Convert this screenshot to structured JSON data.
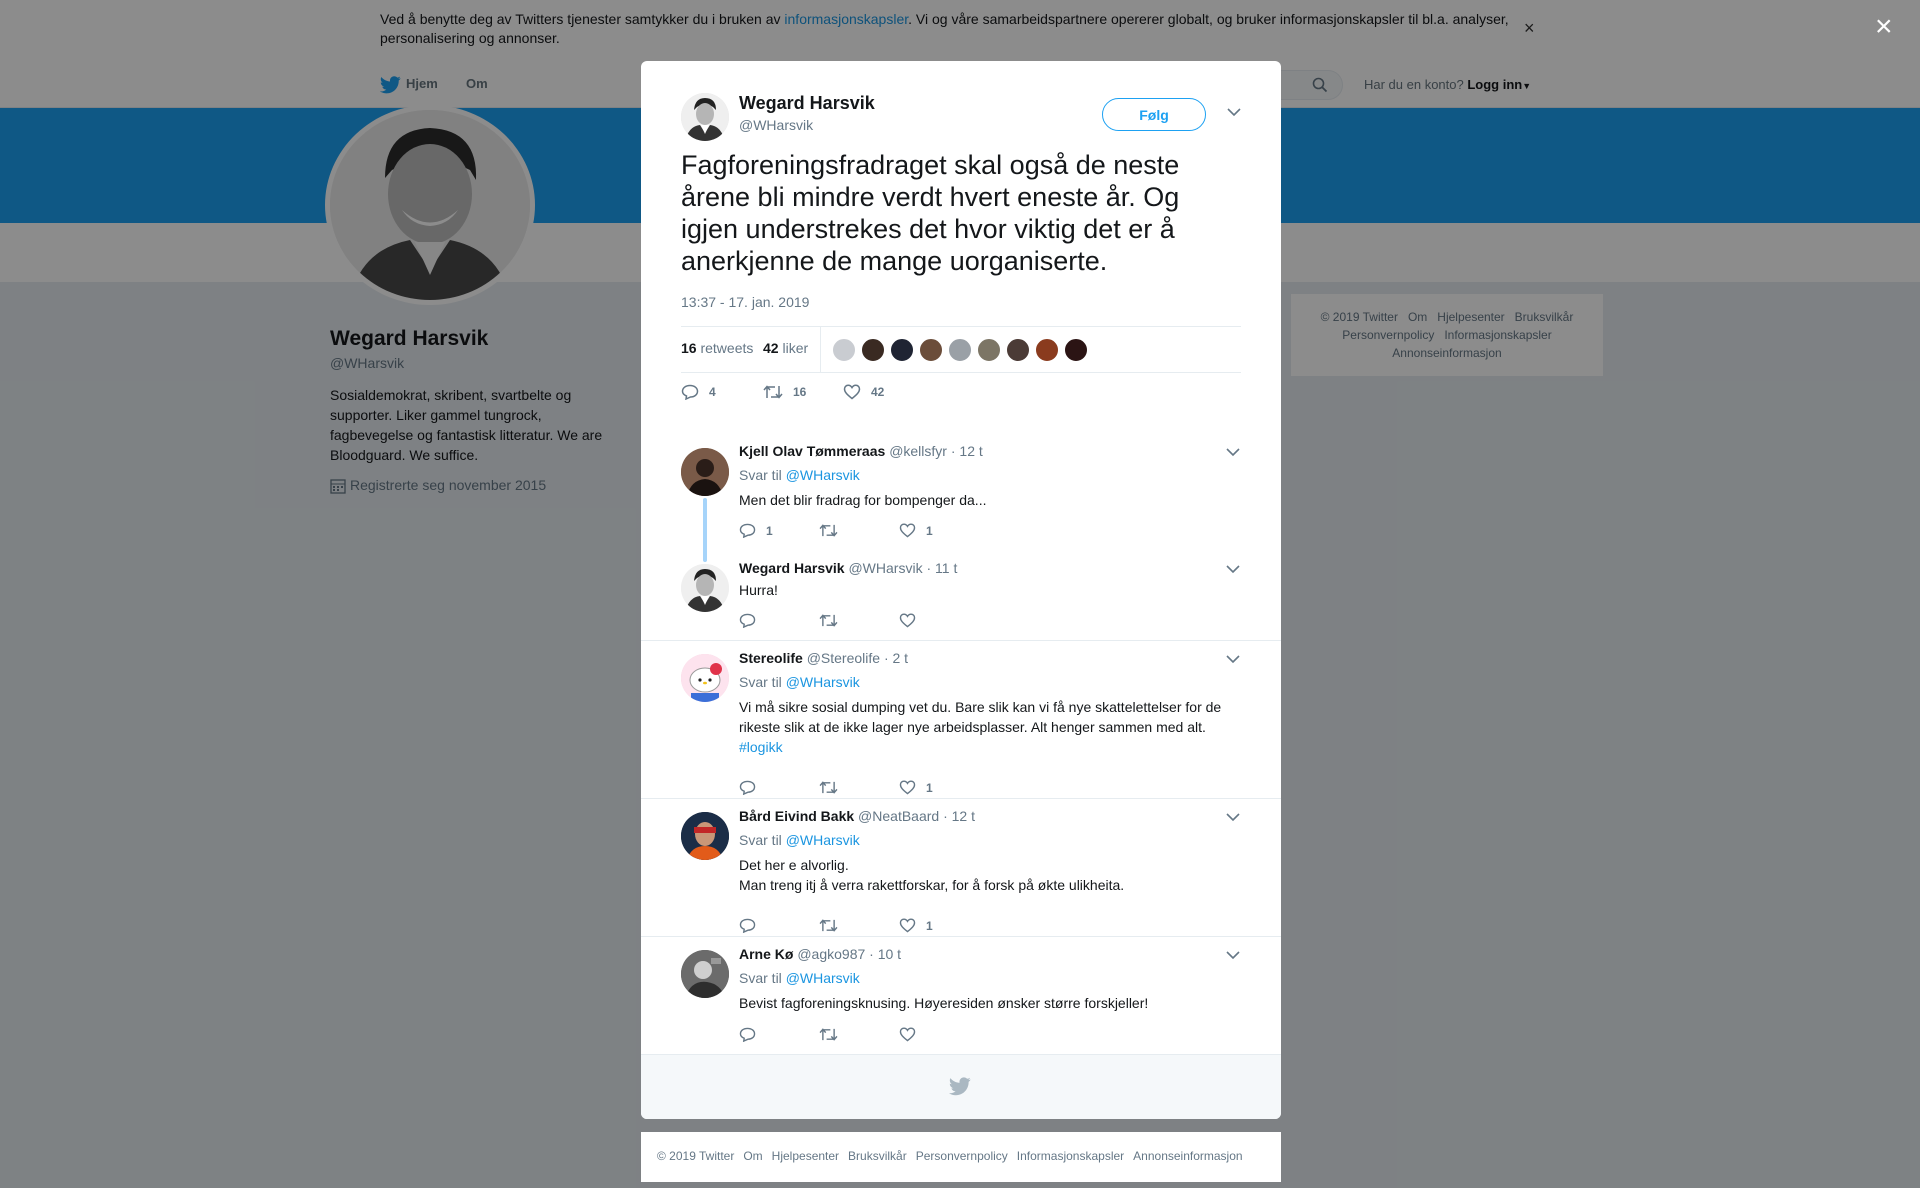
{
  "cookie": {
    "text_before": "Ved å benytte deg av Twitters tjenester samtykker du i bruken av ",
    "link": "informasjonskapsler",
    "text_after": ". Vi og våre samarbeidspartnere opererer globalt, og bruker informasjonskapsler til bl.a. analyser, personalisering og annonser.",
    "close": "×"
  },
  "nav": {
    "home": "Hjem",
    "about": "Om",
    "login_prompt": "Har du en konto?",
    "login": "Logg inn"
  },
  "profile": {
    "name": "Wegard Harsvik",
    "handle": "@WHarsvik",
    "bio": "Sosialdemokrat, skribent, svartbelte og supporter. Liker gammel tungrock, fagbevegelse og fantastisk litteratur. We are Bloodguard. We suffice.",
    "joined": "Registrerte seg november 2015"
  },
  "side_footer": [
    "© 2019 Twitter",
    "Om",
    "Hjelpesenter",
    "Bruksvilkår",
    "Personvernpolicy",
    "Informasjonskapsler",
    "Annonseinformasjon"
  ],
  "overlay_close": "×",
  "tweet": {
    "author_name": "Wegard Harsvik",
    "author_handle": "@WHarsvik",
    "follow": "Følg",
    "text": "Fagforeningsfradraget skal også de neste årene bli mindre verdt hvert eneste år. Og igjen understrekes det hvor viktig det er å anerkjenne de mange uorganiserte.",
    "time": "13:37 - 17. jan. 2019",
    "retweets_count": "16",
    "retweets_label": "retweets",
    "likes_count": "42",
    "likes_label": "liker",
    "replies": "4",
    "retweets": "16",
    "likes": "42"
  },
  "replies": [
    {
      "name": "Kjell Olav Tømmeraas",
      "handle": "@kellsfyr",
      "time": "· 12 t",
      "reply_to_label": "Svar til",
      "reply_to": "@WHarsvik",
      "text": "Men det blir fradrag for bompenger da...",
      "replies": "1",
      "retweets": "",
      "likes": "1"
    },
    {
      "name": "Wegard Harsvik",
      "handle": "@WHarsvik",
      "time": "· 11 t",
      "text": "Hurra!",
      "replies": "",
      "retweets": "",
      "likes": ""
    },
    {
      "name": "Stereolife",
      "handle": "@Stereolife",
      "time": "· 2 t",
      "reply_to_label": "Svar til",
      "reply_to": "@WHarsvik",
      "text": "Vi må sikre sosial dumping vet du. Bare slik kan vi få nye skattelettelser for de rikeste slik at de ikke lager nye arbeidsplasser. Alt henger sammen med alt.",
      "hashtag": "#logikk",
      "replies": "",
      "retweets": "",
      "likes": "1"
    },
    {
      "name": "Bård Eivind Bakk",
      "handle": "@NeatBaard",
      "time": "· 12 t",
      "reply_to_label": "Svar til",
      "reply_to": "@WHarsvik",
      "text_line1": "Det her e alvorlig.",
      "text_line2": "Man treng itj å verra rakettforskar, for å forsk på økte ulikheita.",
      "replies": "",
      "retweets": "",
      "likes": "1"
    },
    {
      "name": "Arne Kø",
      "handle": "@agko987",
      "time": "· 10 t",
      "reply_to_label": "Svar til",
      "reply_to": "@WHarsvik",
      "text": "Bevist fagforeningsknusing. Høyeresiden ønsker større forskjeller!",
      "replies": "",
      "retweets": "",
      "likes": ""
    }
  ],
  "bottom_footer": [
    "© 2019 Twitter",
    "Om",
    "Hjelpesenter",
    "Bruksvilkår",
    "Personvernpolicy",
    "Informasjonskapsler",
    "Annonseinformasjon"
  ],
  "colors": {
    "accent": "#1da1f2",
    "link": "#1b95e0",
    "banner": "#1da1f2",
    "muted": "#657786"
  },
  "icons": [
    "twitter-bird-icon",
    "search-icon",
    "calendar-icon",
    "chevron-down-icon",
    "reply-icon",
    "retweet-icon",
    "heart-icon",
    "close-icon"
  ]
}
